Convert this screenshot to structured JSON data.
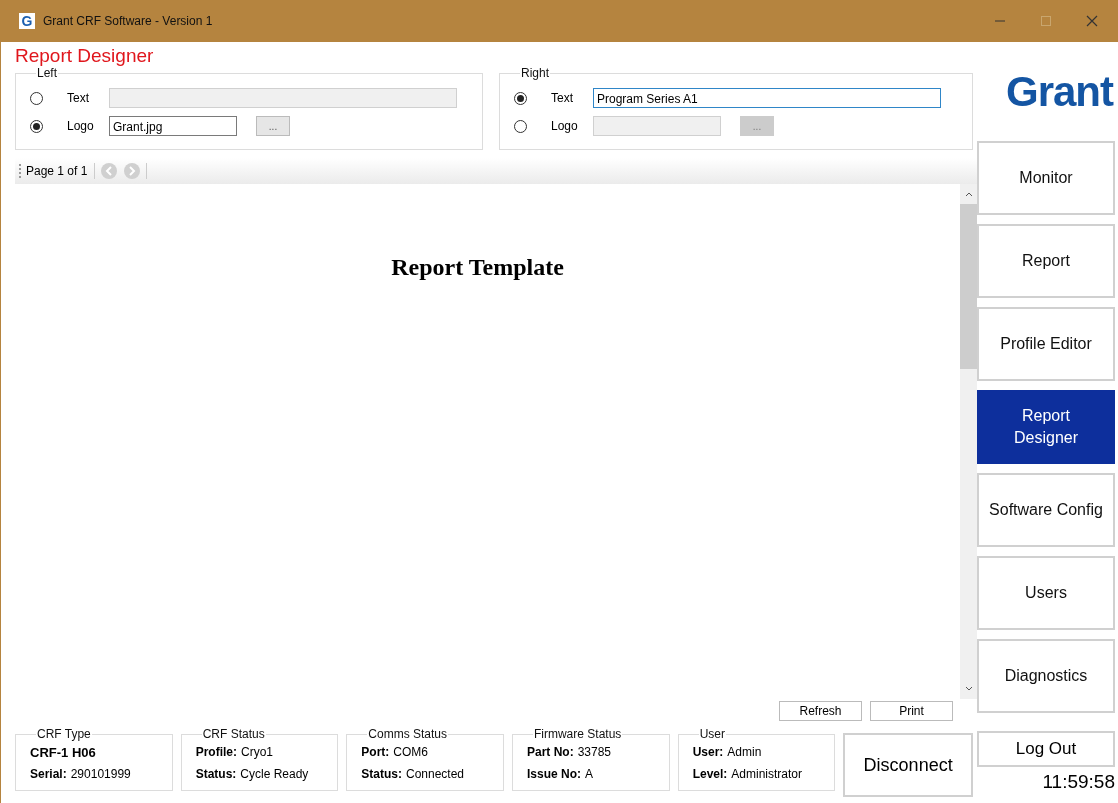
{
  "window": {
    "title": "Grant CRF Software - Version 1",
    "app_icon": "G"
  },
  "page_title": "Report Designer",
  "header_groups": [
    {
      "legend": "Left",
      "options": [
        {
          "label": "Text",
          "selected": false,
          "field_disabled": true
        },
        {
          "label": "Logo",
          "selected": true,
          "value": "Grant.jpg",
          "field_disabled": false,
          "browse": {
            "label": "...",
            "disabled": false
          }
        }
      ]
    },
    {
      "legend": "Right",
      "options": [
        {
          "label": "Text",
          "selected": true,
          "value": "Program Series A1",
          "field_disabled": false,
          "focused": true
        },
        {
          "label": "Logo",
          "selected": false,
          "field_disabled": true,
          "browse": {
            "label": "...",
            "disabled": true
          }
        }
      ]
    }
  ],
  "toolbar": {
    "page": "Page 1 of 1"
  },
  "preview": {
    "title": "Report Template"
  },
  "actions": [
    "Refresh",
    "Print"
  ],
  "status_groups": [
    {
      "legend": "CRF Type",
      "lines": [
        {
          "kind": "heading",
          "value": "CRF-1 H06"
        },
        {
          "kind": "pair",
          "label": "Serial:",
          "value": "290101999"
        }
      ]
    },
    {
      "legend": "CRF Status",
      "lines": [
        {
          "kind": "pair",
          "label": "Profile:",
          "value": "Cryo1"
        },
        {
          "kind": "pair",
          "label": "Status:",
          "value": "Cycle Ready"
        }
      ]
    },
    {
      "legend": "Comms Status",
      "lines": [
        {
          "kind": "pair",
          "label": "Port:",
          "value": "COM6"
        },
        {
          "kind": "pair",
          "label": "Status:",
          "value": "Connected"
        }
      ]
    },
    {
      "legend": "Firmware Status",
      "lines": [
        {
          "kind": "pair",
          "label": "Part No:",
          "value": "33785"
        },
        {
          "kind": "pair",
          "label": "Issue No:",
          "value": "A"
        }
      ]
    },
    {
      "legend": "User",
      "lines": [
        {
          "kind": "pair",
          "label": "User:",
          "value": "Admin"
        },
        {
          "kind": "pair",
          "label": "Level:",
          "value": "Administrator"
        }
      ]
    }
  ],
  "disconnect": "Disconnect",
  "logo": "Grant",
  "nav": [
    {
      "label": "Monitor",
      "selected": false
    },
    {
      "label": "Report",
      "selected": false
    },
    {
      "label": "Profile Editor",
      "selected": false
    },
    {
      "label": "Report Designer",
      "selected": true
    },
    {
      "label": "Software Config",
      "selected": false
    },
    {
      "label": "Users",
      "selected": false
    },
    {
      "label": "Diagnostics",
      "selected": false
    }
  ],
  "logout": "Log Out",
  "clock": "11:59:58"
}
